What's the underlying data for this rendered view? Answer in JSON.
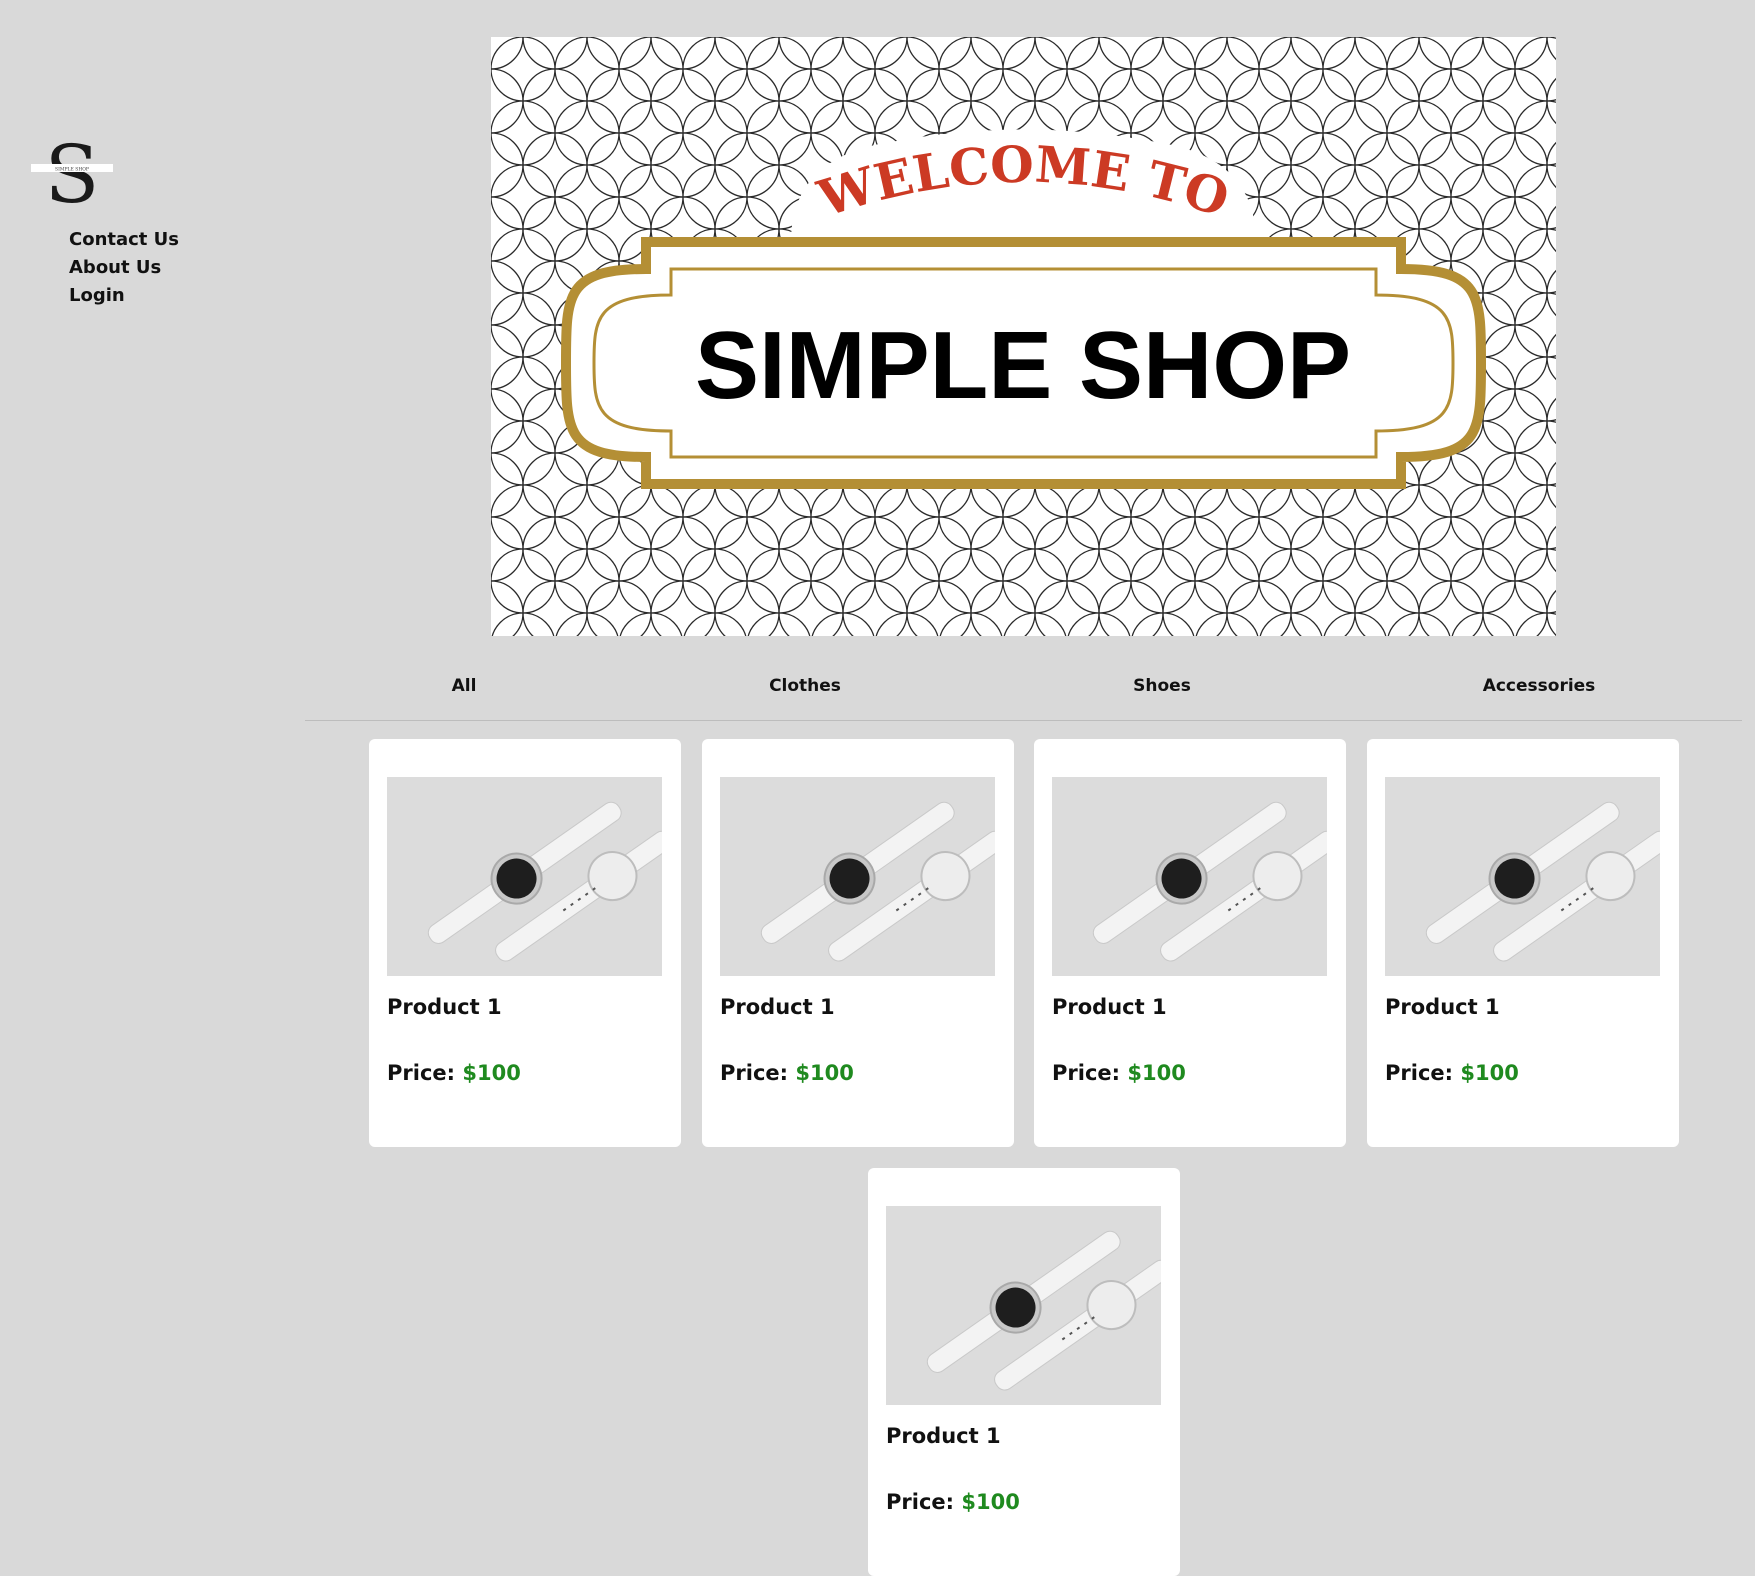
{
  "brand": {
    "logo_letter": "S",
    "logo_caption": "SIMPLE SHOP"
  },
  "nav": {
    "items": [
      {
        "label": "Contact Us"
      },
      {
        "label": "About Us"
      },
      {
        "label": "Login"
      }
    ]
  },
  "banner": {
    "welcome_text": "WELCOME TO",
    "shop_name": "SIMPLE SHOP"
  },
  "tabs": [
    {
      "label": "All"
    },
    {
      "label": "Clothes"
    },
    {
      "label": "Shoes"
    },
    {
      "label": "Accessories"
    }
  ],
  "products": [
    {
      "name": "Product 1",
      "price_label": "Price:",
      "price_value": "$100"
    },
    {
      "name": "Product 1",
      "price_label": "Price:",
      "price_value": "$100"
    },
    {
      "name": "Product 1",
      "price_label": "Price:",
      "price_value": "$100"
    },
    {
      "name": "Product 1",
      "price_label": "Price:",
      "price_value": "$100"
    },
    {
      "name": "Product 1",
      "price_label": "Price:",
      "price_value": "$100"
    }
  ],
  "colors": {
    "page_background": "#d9d9d9",
    "card_background": "#ffffff",
    "price_green": "#1f8a1f",
    "welcome_red": "#cc3a24",
    "frame_gold": "#b48f35",
    "text_dark": "#111111"
  }
}
